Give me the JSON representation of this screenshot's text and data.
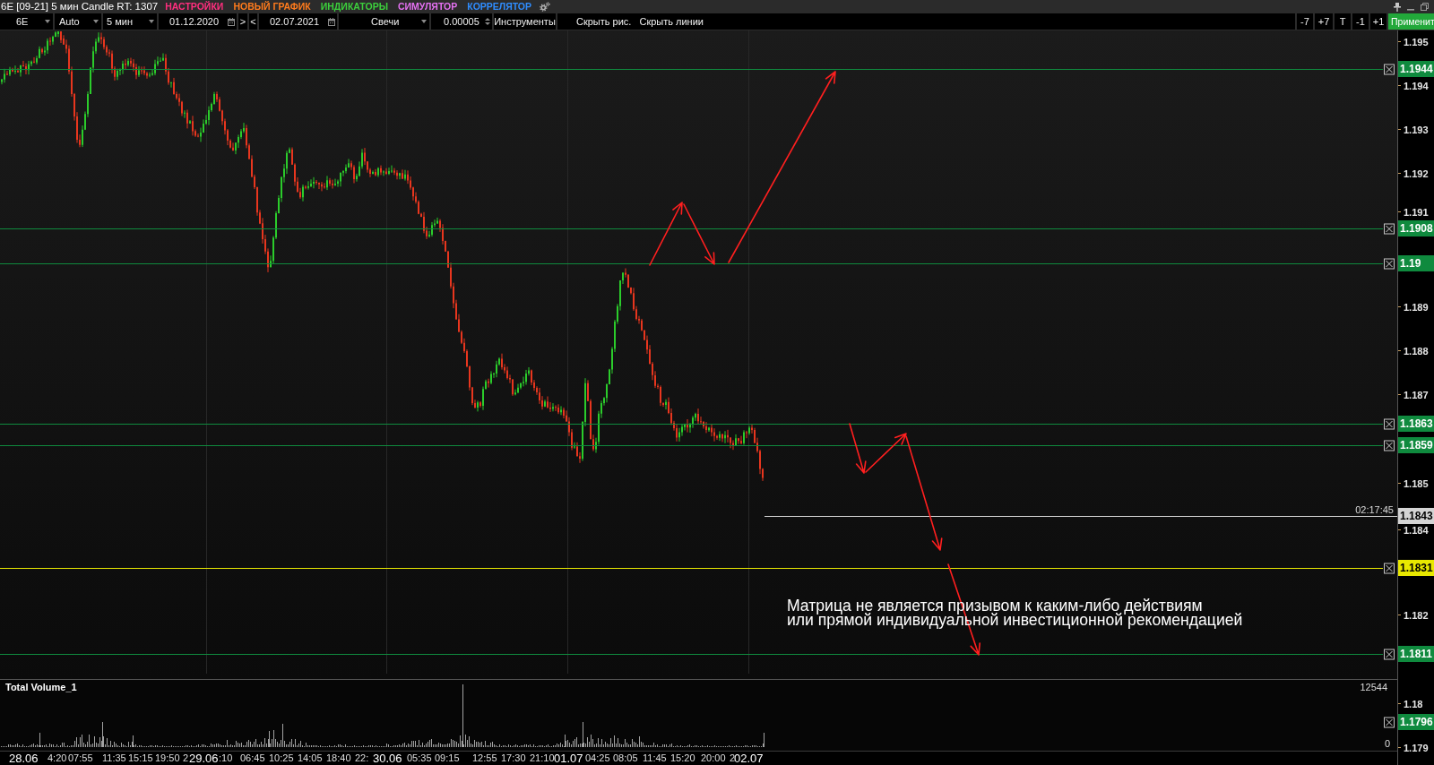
{
  "window": {
    "title": "6E [09-21] 5 мин Candle RT: 1307"
  },
  "menu": [
    {
      "label": "НАСТРОЙКИ",
      "color": "#ff2e7e"
    },
    {
      "label": "НОВЫЙ ГРАФИК",
      "color": "#ff7b1c"
    },
    {
      "label": "ИНДИКАТОРЫ",
      "color": "#3ccf3c"
    },
    {
      "label": "СИМУЛЯТОР",
      "color": "#e471f2"
    },
    {
      "label": "КОРРЕЛЯТОР",
      "color": "#2f8dff"
    }
  ],
  "toolbar": [
    {
      "kind": "dropdown",
      "value": "6E"
    },
    {
      "kind": "dropdown",
      "value": "Auto"
    },
    {
      "kind": "dropdown",
      "value": "5 мин"
    },
    {
      "kind": "date",
      "value": "01.12.2020"
    },
    {
      "kind": "button",
      "label": ">"
    },
    {
      "kind": "button",
      "label": "<"
    },
    {
      "kind": "date",
      "value": "02.07.2021"
    },
    {
      "kind": "dropdown",
      "value": "Свечи"
    },
    {
      "kind": "spinner",
      "value": "0.00005"
    },
    {
      "kind": "button",
      "label": "Инструменты"
    },
    {
      "kind": "link",
      "label": "Скрыть рис."
    },
    {
      "kind": "link",
      "label": "Скрыть линии"
    }
  ],
  "toolbar_right": [
    {
      "kind": "button",
      "label": "-7"
    },
    {
      "kind": "button",
      "label": "+7"
    },
    {
      "kind": "button",
      "label": "T"
    },
    {
      "kind": "button",
      "label": "-1"
    },
    {
      "kind": "button",
      "label": "+1"
    },
    {
      "kind": "apply",
      "label": "Применит"
    }
  ],
  "price_axis": {
    "ticks": [
      "1.195",
      "1.194",
      "1.193",
      "1.192",
      "1.191",
      "1.189",
      "1.188",
      "1.187",
      "1.185",
      "1.184",
      "1.182",
      "1.18",
      "1.179"
    ]
  },
  "levels": [
    {
      "kind": "line",
      "price": "1.1944",
      "color": "#0f8a3e"
    },
    {
      "kind": "line",
      "price": "1.1908",
      "color": "#0f8a3e"
    },
    {
      "kind": "line",
      "price": "1.19",
      "color": "#0f8a3e"
    },
    {
      "kind": "line",
      "price": "1.1863",
      "color": "#0f8a3e"
    },
    {
      "kind": "line",
      "price": "1.1859",
      "color": "#0f8a3e"
    },
    {
      "kind": "current",
      "price": "1.1843",
      "time": "02:17:45",
      "color": "#d4d4d4"
    },
    {
      "kind": "line",
      "price": "1.1831",
      "color": "#e8e800"
    },
    {
      "kind": "line",
      "price": "1.1811",
      "color": "#0f8a3e"
    },
    {
      "kind": "marker",
      "price": "1.1796",
      "color": "#0f8a3e"
    }
  ],
  "volume_pane": {
    "title": "Total Volume_1",
    "max": "12544",
    "min": "0"
  },
  "time_axis": {
    "labels": [
      {
        "text": "28.06",
        "kind": "day"
      },
      {
        "text": "4:20",
        "kind": "time"
      },
      {
        "text": "07:55",
        "kind": "time"
      },
      {
        "text": "11:35",
        "kind": "time"
      },
      {
        "text": "15:15",
        "kind": "time"
      },
      {
        "text": "19:50",
        "kind": "time"
      },
      {
        "text": "2",
        "kind": "time"
      },
      {
        "text": "29.06",
        "kind": "day"
      },
      {
        "text": ":10",
        "kind": "time"
      },
      {
        "text": "06:45",
        "kind": "time"
      },
      {
        "text": "10:25",
        "kind": "time"
      },
      {
        "text": "14:05",
        "kind": "time"
      },
      {
        "text": "18:40",
        "kind": "time"
      },
      {
        "text": "22:",
        "kind": "time"
      },
      {
        "text": "30.06",
        "kind": "day"
      },
      {
        "text": "05:35",
        "kind": "time"
      },
      {
        "text": "09:15",
        "kind": "time"
      },
      {
        "text": "12:55",
        "kind": "time"
      },
      {
        "text": "17:30",
        "kind": "time"
      },
      {
        "text": "21:10",
        "kind": "time"
      },
      {
        "text": "01.07",
        "kind": "day"
      },
      {
        "text": "04:25",
        "kind": "time"
      },
      {
        "text": "08:05",
        "kind": "time"
      },
      {
        "text": "11:45",
        "kind": "time"
      },
      {
        "text": "15:20",
        "kind": "time"
      },
      {
        "text": "20:00",
        "kind": "time"
      },
      {
        "text": "2",
        "kind": "time"
      },
      {
        "text": "02.07",
        "kind": "day"
      }
    ]
  },
  "annotation": {
    "lines": [
      "Матрица не является призывом к каким-либо действиям",
      "или прямой индивидуальной инвестиционной рекомендацией"
    ]
  }
}
